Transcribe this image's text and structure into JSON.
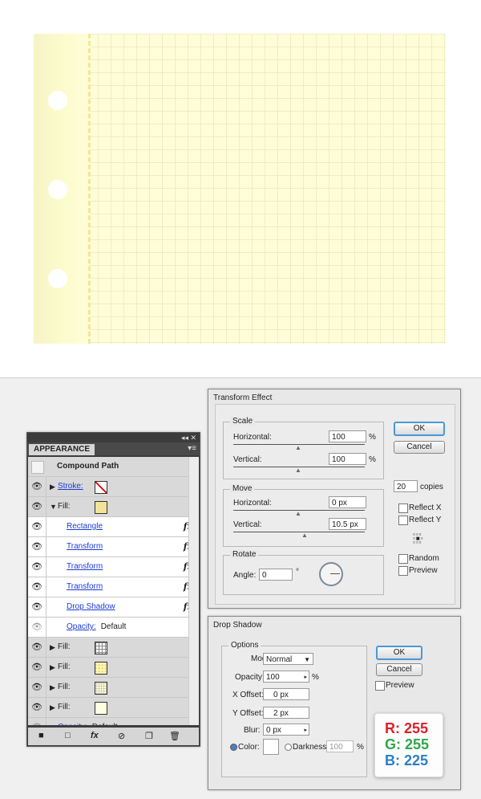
{
  "appearance": {
    "tab": "APPEARANCE",
    "header": "Compound Path",
    "rows": [
      {
        "type": "stroke",
        "label": "Stroke:"
      },
      {
        "type": "fill",
        "label": "Fill:"
      },
      {
        "type": "effect",
        "label": "Rectangle",
        "fx": "fx"
      },
      {
        "type": "effect",
        "label": "Transform",
        "fx": "fx"
      },
      {
        "type": "effect",
        "label": "Transform",
        "fx": "fx"
      },
      {
        "type": "effect",
        "label": "Transform",
        "fx": "fx"
      },
      {
        "type": "effect",
        "label": "Drop Shadow",
        "fx": "fx"
      },
      {
        "type": "opacity",
        "label": "Opacity:",
        "value": "Default"
      },
      {
        "type": "fill",
        "label": "Fill:"
      },
      {
        "type": "fill",
        "label": "Fill:"
      },
      {
        "type": "fill",
        "label": "Fill:"
      },
      {
        "type": "fill",
        "label": "Fill:"
      },
      {
        "type": "opacity",
        "label": "Opacity:",
        "value": "Default"
      }
    ]
  },
  "transform": {
    "title": "Transform Effect",
    "scale": {
      "label": "Scale",
      "h_label": "Horizontal:",
      "h_value": "100",
      "v_label": "Vertical:",
      "v_value": "100",
      "unit": "%"
    },
    "move": {
      "label": "Move",
      "h_label": "Horizontal:",
      "h_value": "0 px",
      "v_label": "Vertical:",
      "v_value": "10.5 px"
    },
    "rotate": {
      "label": "Rotate",
      "angle_label": "Angle:",
      "angle_value": "0",
      "deg": "°"
    },
    "ok": "OK",
    "cancel": "Cancel",
    "copies_value": "20",
    "copies_label": "copies",
    "reflect_x": "Reflect X",
    "reflect_y": "Reflect Y",
    "random": "Random",
    "preview": "Preview"
  },
  "dropshadow": {
    "title": "Drop Shadow",
    "options": "Options",
    "mode_label": "Mode:",
    "mode_value": "Normal",
    "opacity_label": "Opacity:",
    "opacity_value": "100",
    "pct": "%",
    "x_label": "X Offset:",
    "x_value": "0 px",
    "y_label": "Y Offset:",
    "y_value": "2 px",
    "blur_label": "Blur:",
    "blur_value": "0 px",
    "color_label": "Color:",
    "darkness_label": "Darkness:",
    "darkness_value": "100",
    "darkness_pct": "%",
    "ok": "OK",
    "cancel": "Cancel",
    "preview": "Preview",
    "rgb": {
      "r": "R: 255",
      "g": "G: 255",
      "b": "B: 225"
    }
  },
  "colors": {
    "paper": "#fefdd8",
    "red": "#e0202a",
    "green": "#2ea84a",
    "blue": "#2a7fc4",
    "link": "#1c3bd6"
  }
}
